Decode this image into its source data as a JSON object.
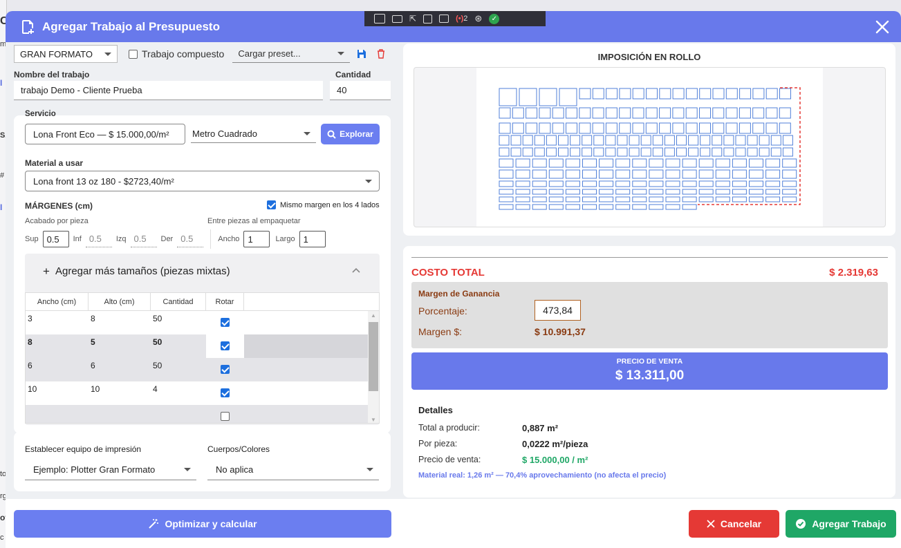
{
  "background": {
    "fragments": [
      "C",
      "m",
      "I",
      "SA",
      "#",
      "I",
      "to",
      "rg",
      "ot",
      "c"
    ]
  },
  "header": {
    "title": "Agregar Trabajo al Presupuesto",
    "close_icon": "close-icon"
  },
  "overlay_toolbar": {
    "recording_count": "2"
  },
  "form": {
    "format_select": "GRAN FORMATO",
    "compound_label": "Trabajo compuesto",
    "compound_checked": false,
    "preset_placeholder": "Cargar preset...",
    "job_name_label": "Nombre del trabajo",
    "job_name_value": "trabajo Demo - Cliente Prueba",
    "quantity_label": "Cantidad",
    "quantity_value": "40",
    "service_label": "Servicio",
    "service_value": "Lona Front Eco  —  $ 15.000,00/m²",
    "unit_select": "Metro Cuadrado",
    "explore_label": "Explorar",
    "material_label": "Material a usar",
    "material_value": "Lona front 13 oz 180 - $2723,40/m²",
    "margins_label": "MÁRGENES (cm)",
    "same_margin_label": "Mismo margen en los 4 lados",
    "same_margin_checked": true,
    "finish_label": "Acabado por pieza",
    "between_label": "Entre piezas al empaquetar",
    "sup_label": "Sup",
    "sup_value": "0.5",
    "inf_label": "Inf",
    "inf_value": "0.5",
    "izq_label": "Izq",
    "izq_value": "0.5",
    "der_label": "Der",
    "der_value": "0.5",
    "ancho_label": "Ancho",
    "ancho_value": "1",
    "largo_label": "Largo",
    "largo_value": "1"
  },
  "mixed_sizes": {
    "title": "Agregar más tamaños (piezas mixtas)",
    "columns": [
      "Ancho (cm)",
      "Alto (cm)",
      "Cantidad",
      "Rotar"
    ],
    "rows": [
      {
        "ancho": "3",
        "alto": "8",
        "cantidad": "50",
        "rotar": true
      },
      {
        "ancho": "8",
        "alto": "5",
        "cantidad": "50",
        "rotar": true
      },
      {
        "ancho": "6",
        "alto": "6",
        "cantidad": "50",
        "rotar": true
      },
      {
        "ancho": "10",
        "alto": "10",
        "cantidad": "4",
        "rotar": true
      },
      {
        "ancho": "",
        "alto": "",
        "cantidad": "",
        "rotar": false
      }
    ]
  },
  "equipment": {
    "equip_label": "Establecer equipo de impresión",
    "equip_value": "Ejemplo: Plotter Gran Formato",
    "colors_label": "Cuerpos/Colores",
    "colors_value": "No aplica"
  },
  "imposition": {
    "title": "IMPOSICIÓN EN ROLLO"
  },
  "cost": {
    "total_label": "COSTO TOTAL",
    "total_value": "$ 2.319,63",
    "margin_title": "Margen de Ganancia",
    "percent_label": "Porcentaje:",
    "percent_value": "473,84",
    "margin_money_label": "Margen $:",
    "margin_money_value": "$ 10.991,37",
    "sale_label": "PRECIO DE VENTA",
    "sale_value": "$ 13.311,00"
  },
  "details": {
    "title": "Detalles",
    "total_label": "Total a producir:",
    "total_value": "0,887 m²",
    "piece_label": "Por pieza:",
    "piece_value": "0,0222 m²/pieza",
    "price_label": "Precio de venta:",
    "price_value": "$ 15.000,00 / m²",
    "note": "Material real: 1,26 m² — 70,4% aprovechamiento (no afecta el precio)"
  },
  "footer": {
    "optimize_label": "Optimizar y calcular",
    "cancel_label": "Cancelar",
    "add_label": "Agregar Trabajo"
  },
  "colors": {
    "accent": "#6879eb",
    "danger": "#e53935",
    "success": "#1fa766",
    "margin_text": "#8a3b12"
  }
}
